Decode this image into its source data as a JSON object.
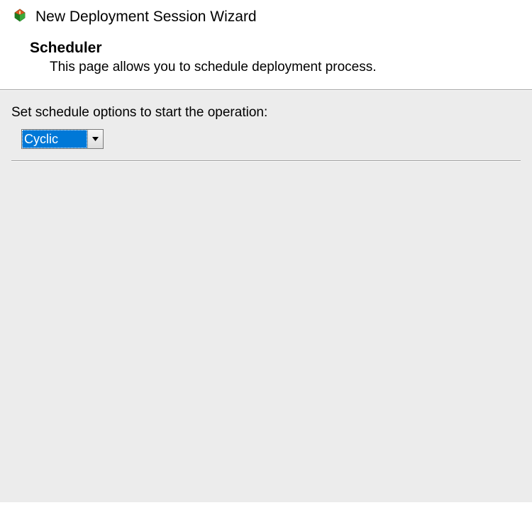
{
  "header": {
    "window_title": "New Deployment Session Wizard",
    "page_title": "Scheduler",
    "page_description": "This page allows you to schedule deployment process."
  },
  "content": {
    "schedule_label": "Set schedule options to start the operation:",
    "schedule_dropdown": {
      "selected": "Cyclic"
    }
  }
}
